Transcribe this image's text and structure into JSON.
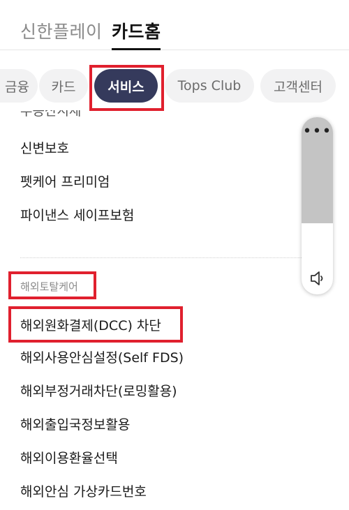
{
  "top_tabs": [
    {
      "label": "신한플레이",
      "active": false
    },
    {
      "label": "카드홈",
      "active": true
    }
  ],
  "chips": [
    {
      "label": "금융",
      "active": false
    },
    {
      "label": "카드",
      "active": false
    },
    {
      "label": "서비스",
      "active": true
    },
    {
      "label": "Tops Club",
      "active": false
    },
    {
      "label": "고객센터",
      "active": false
    }
  ],
  "menu": {
    "clipped_item": "부동산시세",
    "items_top": [
      "신변보호",
      "펫케어 프리미엄",
      "파이낸스 세이프보험"
    ],
    "section_label": "해외토탈케어",
    "items_section": [
      "해외원화결제(DCC) 차단",
      "해외사용안심설정(Self FDS)",
      "해외부정거래차단(로밍활용)",
      "해외출입국정보활용",
      "해외이용환율선택",
      "해외안심 가상카드번호"
    ]
  },
  "widget": {
    "dots": "•••",
    "speaker_icon": "speaker-icon"
  },
  "colors": {
    "active_chip": "#353a5c",
    "highlight_box": "#e0202e",
    "chip_bg": "#f2f2f3"
  }
}
